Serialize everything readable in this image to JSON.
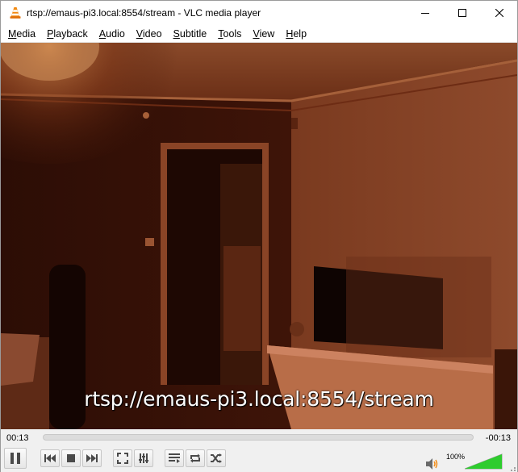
{
  "window": {
    "title": "rtsp://emaus-pi3.local:8554/stream - VLC media player",
    "app_icon": "vlc-cone-icon"
  },
  "menu": {
    "items": [
      {
        "label": "Media",
        "accel": "M",
        "rest": "edia"
      },
      {
        "label": "Playback",
        "accel": "P",
        "rest": "layback"
      },
      {
        "label": "Audio",
        "accel": "A",
        "rest": "udio"
      },
      {
        "label": "Video",
        "accel": "V",
        "rest": "ideo"
      },
      {
        "label": "Subtitle",
        "accel": "S",
        "rest": "ubtitle"
      },
      {
        "label": "Tools",
        "accel": "T",
        "rest": "ools"
      },
      {
        "label": "View",
        "accel": "V",
        "rest": "iew"
      },
      {
        "label": "Help",
        "accel": "H",
        "rest": "elp"
      }
    ]
  },
  "video": {
    "overlay_text": "rtsp://emaus-pi3.local:8554/stream"
  },
  "seek": {
    "elapsed": "00:13",
    "remaining": "-00:13",
    "position_fraction": 0.0
  },
  "controls": {
    "icons": [
      "pause-icon",
      "previous-icon",
      "stop-icon",
      "next-icon",
      "fullscreen-icon",
      "extended-settings-icon",
      "playlist-icon",
      "loop-icon",
      "random-icon"
    ]
  },
  "volume": {
    "label": "100%",
    "level_percent": 100,
    "icon": "speaker-icon",
    "fill_color": "#2ecc2e"
  }
}
